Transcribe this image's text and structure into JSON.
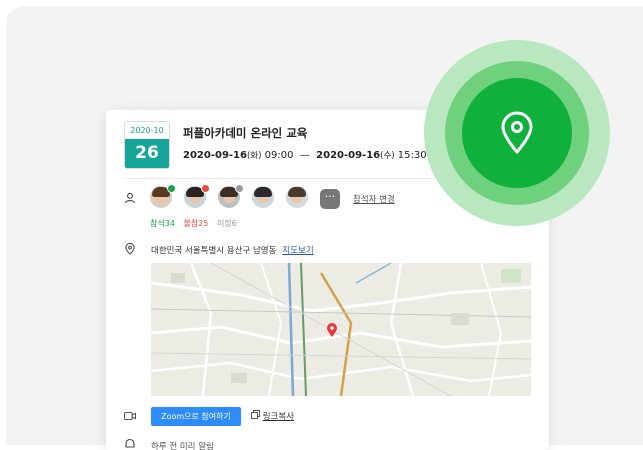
{
  "event": {
    "month_label": "2020-10",
    "day_label": "26",
    "title": "퍼플아카데미 온라인 교육",
    "start_date": "2020-09-16",
    "start_dow": "(화)",
    "start_time": "09:00",
    "dash": "—",
    "end_date": "2020-09-16",
    "end_dow": "(수)",
    "end_time": "15:30"
  },
  "participants": {
    "more_label": "···",
    "change_label": "참석자 변경",
    "attend_label": "참석",
    "attend_count": "34",
    "absent_label": "불참",
    "absent_count": "25",
    "undecided_label": "미정",
    "undecided_count": "6",
    "avatars": [
      {
        "status": "attend",
        "status_color": "#19a34a"
      },
      {
        "status": "absent",
        "status_color": "#e74c3c"
      },
      {
        "status": "undecided",
        "status_color": "#9a9a9a"
      },
      {
        "status": "none"
      },
      {
        "status": "none"
      }
    ]
  },
  "location": {
    "address": "대한민국 서울특별시 용산구 남영동",
    "map_link": "지도보기"
  },
  "meeting": {
    "zoom_button": "Zoom으로 참여하기",
    "copy_link": "링크복사"
  },
  "reminder": {
    "text": "하루 전 미리 알림"
  },
  "colors": {
    "accent_green": "#0fb13c",
    "date_teal": "#17a59a",
    "zoom_blue": "#2d8cff",
    "map_pin_red": "#e53935"
  },
  "icons": [
    "person-icon",
    "location-pin-icon",
    "video-camera-icon",
    "bell-icon",
    "copy-icon",
    "map-marker-icon"
  ]
}
